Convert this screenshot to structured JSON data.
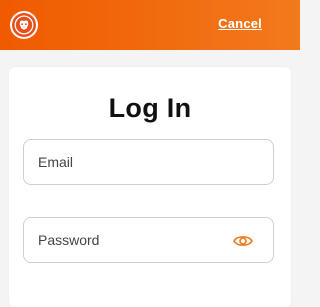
{
  "header": {
    "logo_icon": "lion-logo-icon",
    "cancel_label": "Cancel",
    "accent_start": "#f05a00",
    "accent_end": "#f27a1c"
  },
  "login": {
    "title": "Log In",
    "email": {
      "placeholder": "Email",
      "value": ""
    },
    "password": {
      "placeholder": "Password",
      "value": "",
      "toggle_icon": "eye-icon",
      "icon_color": "#f07a1e"
    }
  }
}
